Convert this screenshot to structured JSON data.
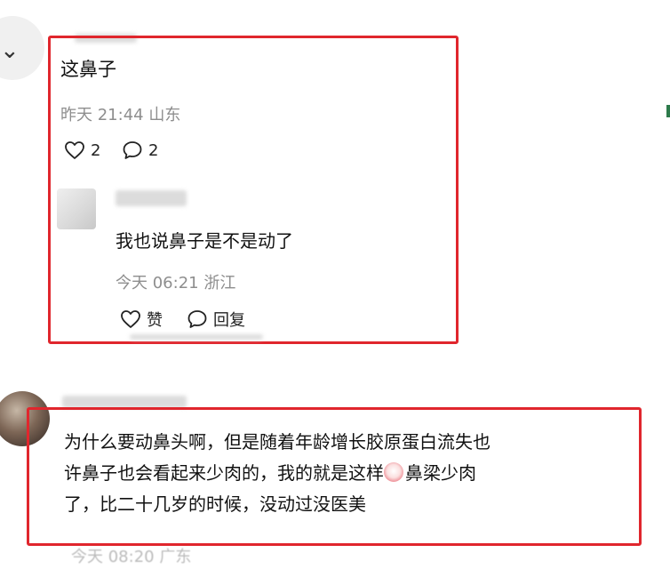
{
  "top_comment": {
    "text": "这鼻子",
    "time": "昨天 21:44",
    "location": "山东",
    "like_count": "2",
    "reply_count": "2"
  },
  "reply": {
    "text": "我也说鼻子是不是动了",
    "time": "今天 06:21",
    "location": "浙江",
    "like_label": "赞",
    "reply_label": "回复"
  },
  "second_comment": {
    "lines": [
      "为什么要动鼻头啊，但是随着年龄增长胶原蛋白流失也",
      "许鼻子也会看起来少肉的，我的就是这样",
      "鼻梁少肉",
      "了，比二十几岁的时候，没动过没医美"
    ],
    "emoji_icon": "crying-face-emoji",
    "time_partial": "今天 08:20 广东",
    "more_label": "···"
  },
  "colors": {
    "highlight_border": "#e0262d",
    "meta_text": "#8e8e8e"
  }
}
